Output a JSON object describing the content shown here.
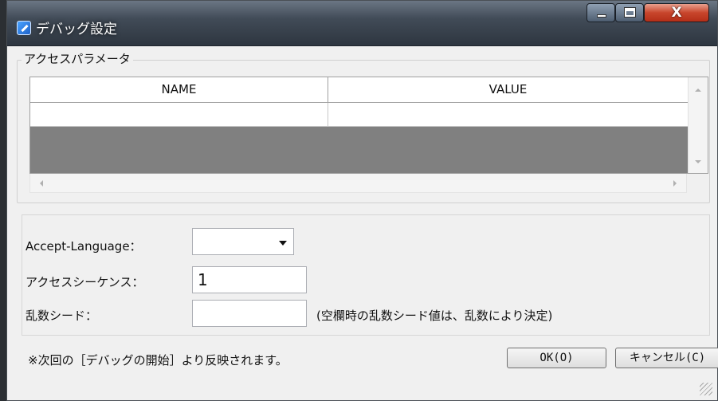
{
  "window": {
    "title": "デバッグ設定",
    "close_glyph": "X"
  },
  "access_params": {
    "group_label": "アクセスパラメータ",
    "columns": [
      "NAME",
      "VALUE"
    ],
    "rows": [
      {
        "name": "",
        "value": ""
      }
    ]
  },
  "form": {
    "accept_language_label": "Accept-Language：",
    "accept_language_value": "",
    "access_sequence_label": "アクセスシーケンス：",
    "access_sequence_value": "1",
    "random_seed_label": "乱数シード：",
    "random_seed_value": "",
    "random_seed_hint": "(空欄時の乱数シード値は、乱数により決定)"
  },
  "footer": {
    "note": "※次回の［デバッグの開始］より反映されます。",
    "ok_label": "OK(O)",
    "cancel_label": "キャンセル(C)"
  },
  "icons": [
    "app-icon",
    "minimize-icon",
    "maximize-icon",
    "close-icon",
    "scroll-up-icon",
    "scroll-down-icon",
    "scroll-left-icon",
    "scroll-right-icon",
    "dropdown-arrow-icon",
    "resize-grip-icon"
  ]
}
